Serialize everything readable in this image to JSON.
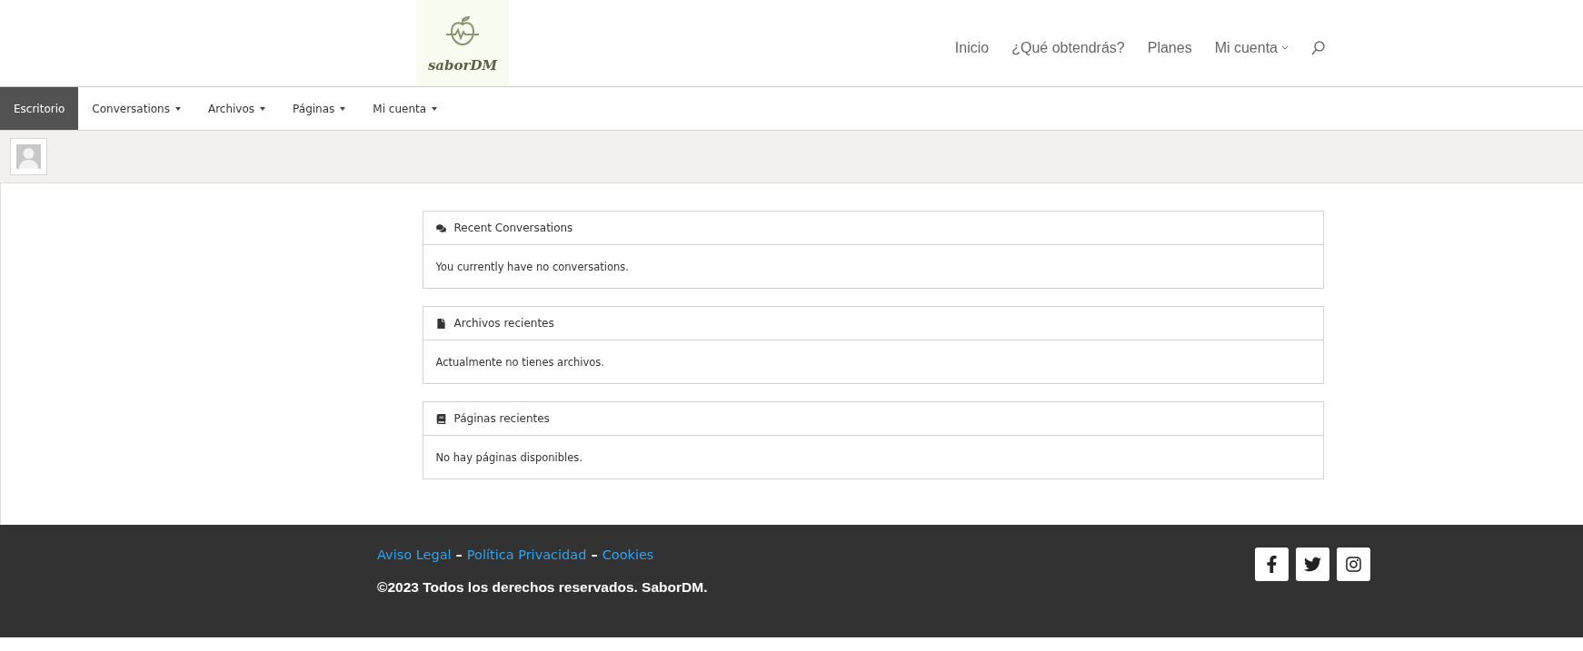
{
  "logo": {
    "text": "saborDM"
  },
  "main_nav": [
    {
      "label": "Inicio",
      "has_dropdown": false
    },
    {
      "label": "¿Qué obtendrás?",
      "has_dropdown": false
    },
    {
      "label": "Planes",
      "has_dropdown": false
    },
    {
      "label": "Mi cuenta",
      "has_dropdown": true
    }
  ],
  "admin_menu": [
    {
      "label": "Escritorio",
      "selected": true,
      "has_dropdown": false
    },
    {
      "label": "Conversations",
      "selected": false,
      "has_dropdown": true
    },
    {
      "label": "Archivos",
      "selected": false,
      "has_dropdown": true
    },
    {
      "label": "Páginas",
      "selected": false,
      "has_dropdown": true
    },
    {
      "label": "Mi cuenta",
      "selected": false,
      "has_dropdown": true
    }
  ],
  "panels": [
    {
      "kind": "conversations",
      "title": "Recent Conversations",
      "body": "You currently have no conversations."
    },
    {
      "kind": "files",
      "title": "Archivos recientes",
      "body": "Actualmente no tienes archivos."
    },
    {
      "kind": "pages",
      "title": "Páginas recientes",
      "body": "No hay páginas disponibles."
    }
  ],
  "footer": {
    "link_line": [
      {
        "kind": "link",
        "text": "Aviso Legal"
      },
      {
        "kind": "separator",
        "text": "–"
      },
      {
        "kind": "link",
        "text": "Política Privacidad"
      },
      {
        "kind": "separator",
        "text": "–"
      },
      {
        "kind": "link",
        "text": "Cookies"
      }
    ],
    "copyright": "©2023 Todos los derechos reservados. SaborDM.",
    "social": [
      {
        "kind": "facebook"
      },
      {
        "kind": "twitter"
      },
      {
        "kind": "instagram"
      }
    ]
  }
}
